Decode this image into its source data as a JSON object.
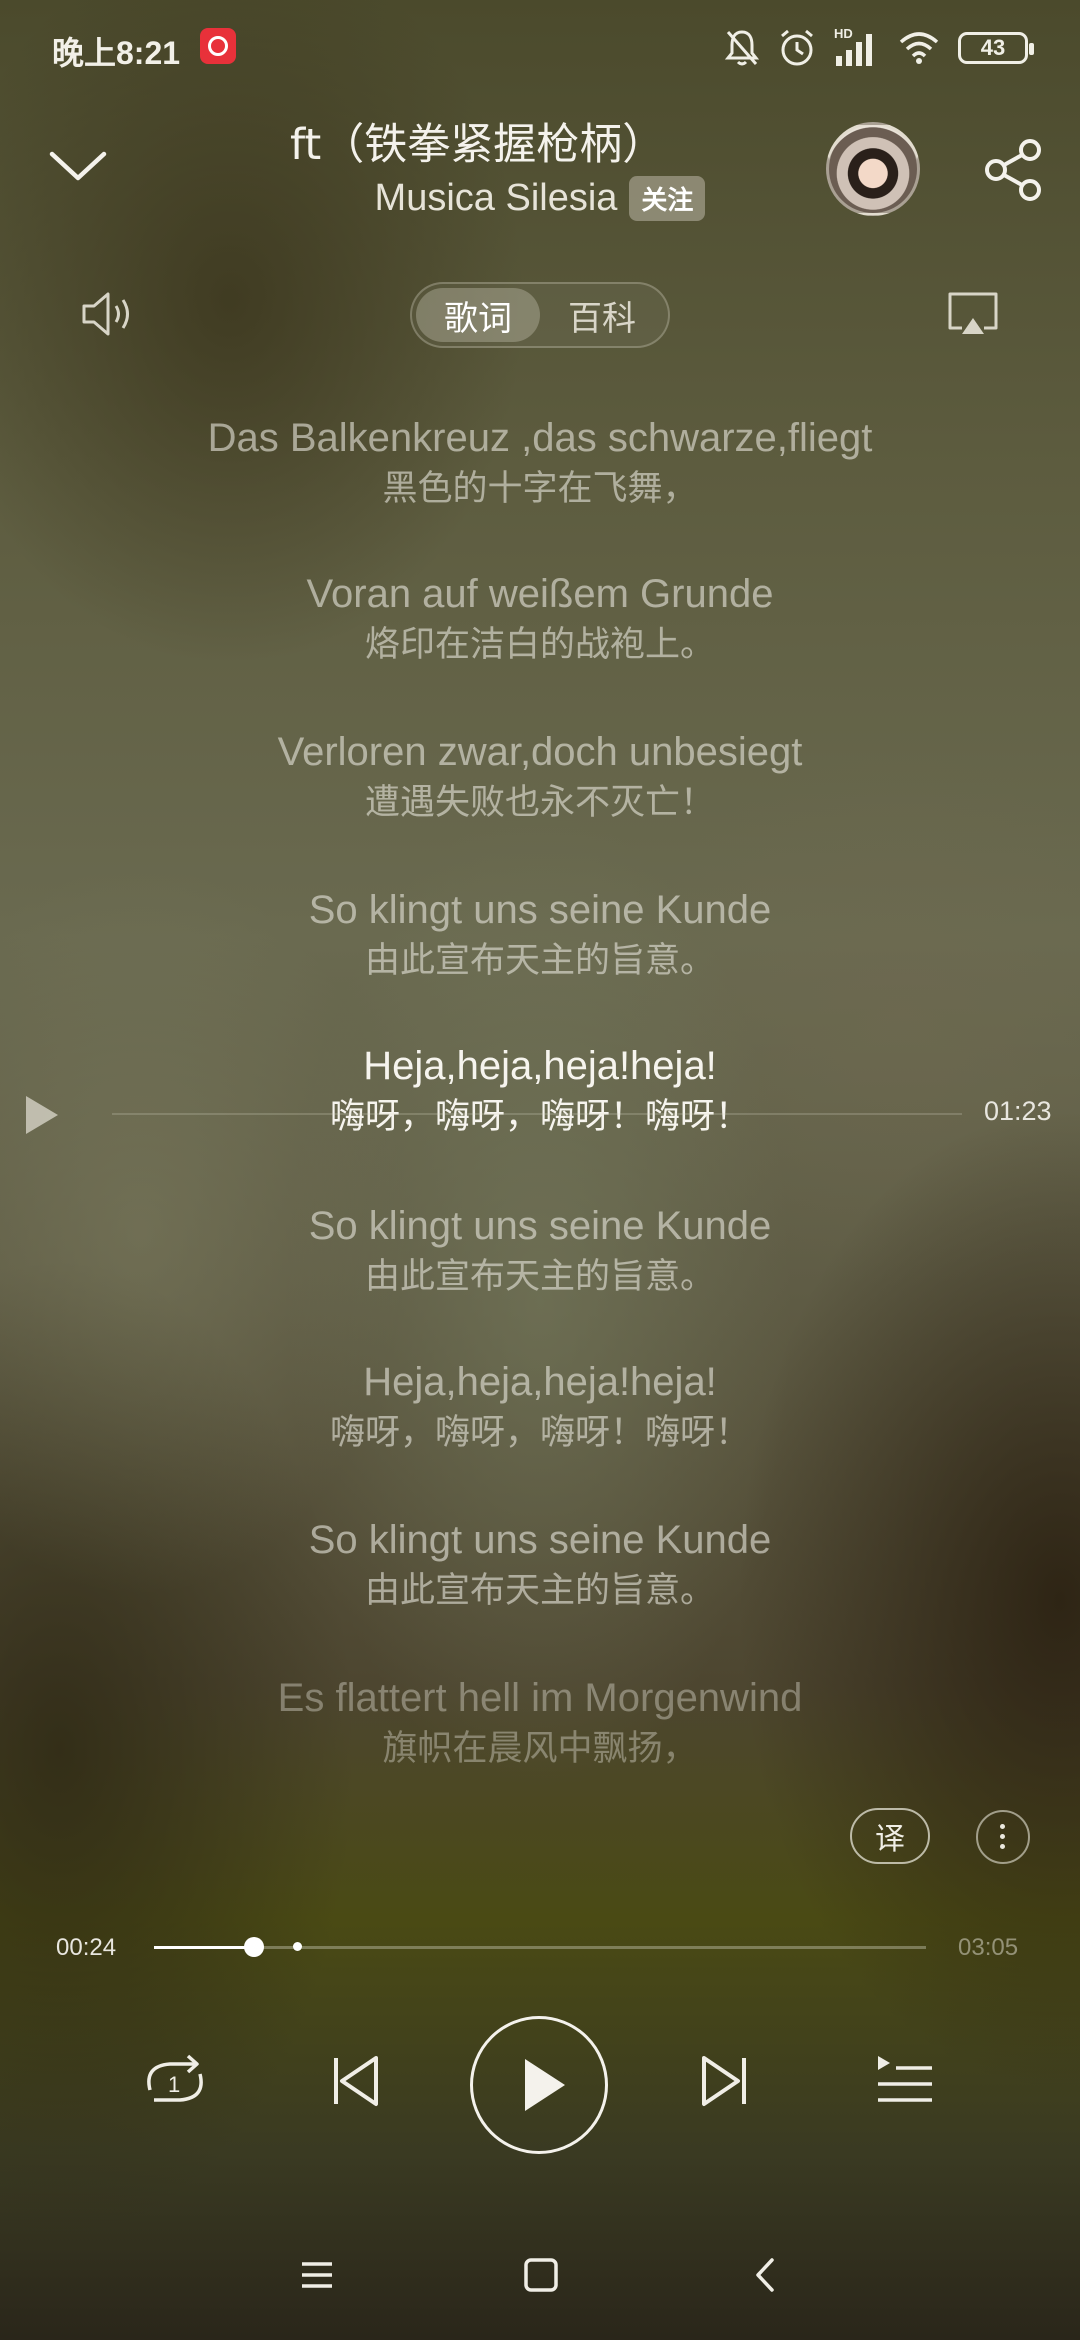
{
  "status_bar": {
    "time": "晚上8:21",
    "battery": "43",
    "network_badge": "HD",
    "icons": [
      "app-badge-icon",
      "mute-bell-icon",
      "alarm-icon",
      "signal-icon",
      "wifi-icon",
      "battery-icon"
    ]
  },
  "header": {
    "song_title": "ft（铁拳紧握枪柄）",
    "artist": "Musica Silesia",
    "follow_label": "关注"
  },
  "tabs": [
    {
      "label": "歌词",
      "active": true
    },
    {
      "label": "百科",
      "active": false
    }
  ],
  "lyrics": [
    {
      "de": "Das Balkenkreuz ,das schwarze,fliegt",
      "zh": "黑色的十字在飞舞，",
      "state": "normal"
    },
    {
      "de": "Voran auf weißem Grunde",
      "zh": "烙印在洁白的战袍上。",
      "state": "normal"
    },
    {
      "de": "Verloren zwar,doch unbesiegt",
      "zh": "遭遇失败也永不灭亡！",
      "state": "normal"
    },
    {
      "de": "So klingt uns seine Kunde",
      "zh": "由此宣布天主的旨意。",
      "state": "normal"
    },
    {
      "de": "Heja,heja,heja!heja!",
      "zh": "嗨呀，嗨呀，嗨呀！嗨呀！",
      "state": "current"
    },
    {
      "de": "So klingt uns seine Kunde",
      "zh": "由此宣布天主的旨意。",
      "state": "normal"
    },
    {
      "de": "Heja,heja,heja!heja!",
      "zh": "嗨呀，嗨呀，嗨呀！嗨呀！",
      "state": "normal"
    },
    {
      "de": "So klingt uns seine Kunde",
      "zh": "由此宣布天主的旨意。",
      "state": "normal"
    },
    {
      "de": "Es flattert hell im Morgenwind",
      "zh": "旗帜在晨风中飘扬，",
      "state": "faded"
    }
  ],
  "lyric_seek_time": "01:23",
  "translate_label": "译",
  "player": {
    "current_time": "00:24",
    "total_time": "03:05",
    "progress": 0.13,
    "buffered": 0.185
  },
  "colors": {
    "accent": "#ffffff",
    "lyric_dim": "#e4e2d8",
    "badge_red": "#e8313a"
  }
}
